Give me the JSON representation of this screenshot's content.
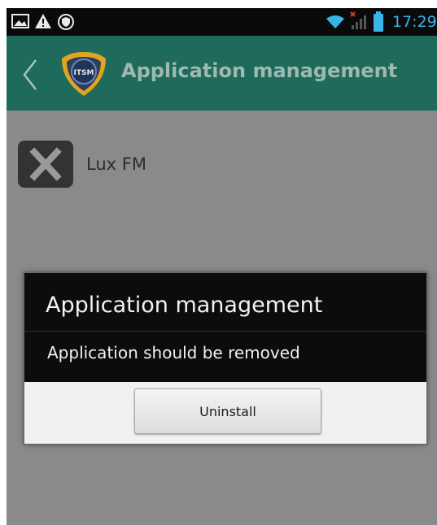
{
  "status_bar": {
    "time": "17:29",
    "left_icons": [
      "picture-icon",
      "warning-icon",
      "shield-icon"
    ],
    "right_icons": [
      "wifi-icon",
      "signal-icon",
      "battery-icon"
    ],
    "accent_color": "#39b4e8"
  },
  "action_bar": {
    "title": "Application management",
    "logo_text": "ITSM",
    "background_color": "#1e6b5b"
  },
  "app_item": {
    "name": "Lux FM",
    "icon": "close-x-icon"
  },
  "dialog": {
    "title": "Application management",
    "message": "Application should be removed",
    "button_label": "Uninstall"
  }
}
